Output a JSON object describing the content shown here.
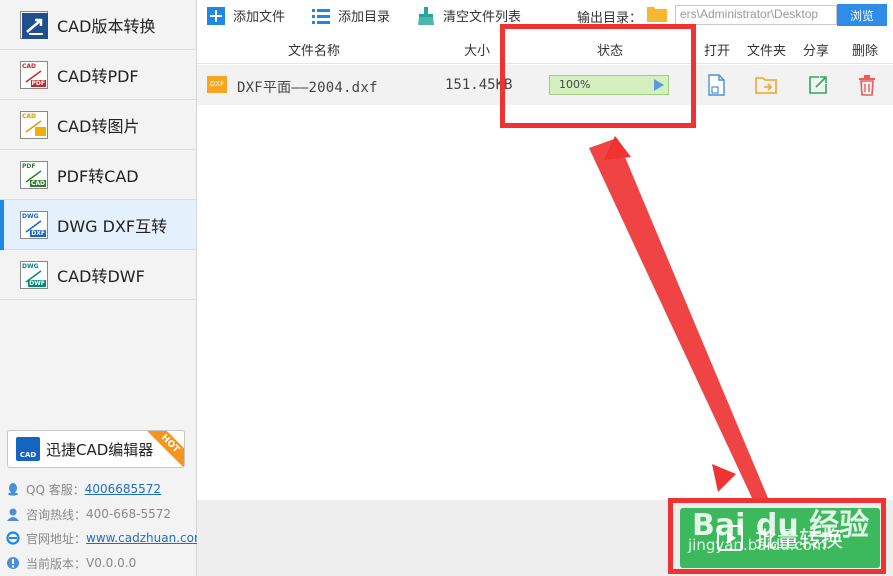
{
  "sidebar": {
    "items": [
      {
        "label": "CAD版本转换",
        "icon": "cad-version-convert-icon",
        "active": false
      },
      {
        "label": "CAD转PDF",
        "icon": "cad-to-pdf-icon",
        "active": false
      },
      {
        "label": "CAD转图片",
        "icon": "cad-to-image-icon",
        "active": false
      },
      {
        "label": "PDF转CAD",
        "icon": "pdf-to-cad-icon",
        "active": false
      },
      {
        "label": "DWG DXF互转",
        "icon": "dwg-dxf-convert-icon",
        "active": true
      },
      {
        "label": "CAD转DWF",
        "icon": "cad-to-dwf-icon",
        "active": false
      }
    ],
    "editor_button": {
      "label": "迅捷CAD编辑器",
      "badge": "HOT"
    },
    "contacts": [
      {
        "label": "QQ 客服：",
        "value": "4006685572",
        "icon": "qq-icon",
        "link": true
      },
      {
        "label": "咨询热线：",
        "value": "400-668-5572",
        "icon": "phone-headset-icon",
        "link": false
      },
      {
        "label": "官网地址：",
        "value": "www.cadzhuan.com",
        "icon": "ie-browser-icon",
        "link": true
      },
      {
        "label": "当前版本：",
        "value": "V0.0.0.0",
        "icon": "version-icon",
        "link": false
      }
    ]
  },
  "toolbar": {
    "add_file": "添加文件",
    "add_folder": "添加目录",
    "clear_list": "清空文件列表",
    "output_label": "输出目录：",
    "output_path": "ers\\Administrator\\Desktop",
    "browse": "浏览"
  },
  "table": {
    "headers": {
      "name": "文件名称",
      "size": "大小",
      "status": "状态",
      "open": "打开",
      "folder": "文件夹",
      "share": "分享",
      "delete": "删除"
    },
    "rows": [
      {
        "file_type": "DXF",
        "name": "DXF平面——2004.dxf",
        "size": "151.45KB",
        "progress_text": "100%",
        "progress": 1.0
      }
    ]
  },
  "bottom": {
    "batch_convert": "批量转换"
  },
  "watermark": {
    "brand": "Bai du 经验",
    "url": "jingyan.baidu.com"
  },
  "colors": {
    "accent": "#2e8de8",
    "active_bg": "#e4f0fb",
    "annotation": "#ef3333",
    "progress_border": "#9ed07d",
    "batch_button": "#3cb85d",
    "hot_badge": "#f7941d"
  }
}
